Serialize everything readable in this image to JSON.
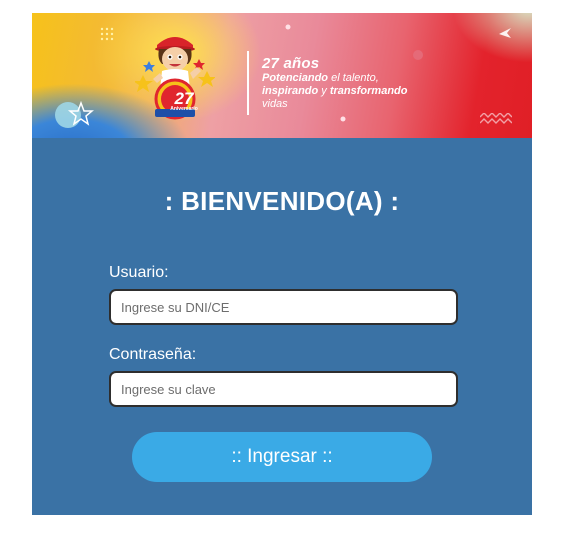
{
  "banner": {
    "badge_number": "27",
    "badge_caption": "Aniversario",
    "title": "27 años",
    "subtitle_bold1": "Potenciando",
    "subtitle_text1": " el talento,",
    "subtitle_bold2": "inspirando",
    "subtitle_text2": " y ",
    "subtitle_bold3": "transformando",
    "subtitle_text3": "vidas"
  },
  "login": {
    "welcome": ": BIENVENIDO(A) :",
    "user_label": "Usuario:",
    "user_placeholder": "Ingrese su DNI/CE",
    "user_value": "",
    "password_label": "Contraseña:",
    "password_placeholder": "Ingrese su clave",
    "password_value": "",
    "submit_label": ":: Ingresar ::"
  },
  "colors": {
    "card_background": "#3a72a5",
    "button_background": "#3aaae6",
    "banner_yellow": "#f6c21a",
    "banner_red": "#e01f26"
  }
}
